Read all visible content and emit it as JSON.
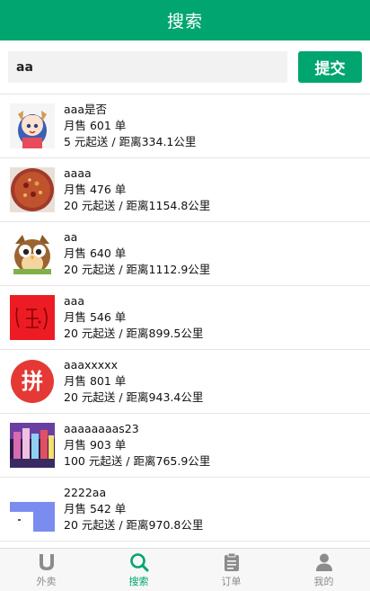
{
  "header": {
    "title": "搜索"
  },
  "search": {
    "value": "aa",
    "submit_label": "提交"
  },
  "shops": [
    {
      "name": "aaa是否",
      "sales": "月售 601 单",
      "delivery": "5 元起送 / 距离334.1公里"
    },
    {
      "name": "aaaa",
      "sales": "月售 476 单",
      "delivery": "20 元起送 / 距离1154.8公里"
    },
    {
      "name": "aa",
      "sales": "月售 640 单",
      "delivery": "20 元起送 / 距离1112.9公里"
    },
    {
      "name": "aaa",
      "sales": "月售 546 单",
      "delivery": "20 元起送 / 距离899.5公里"
    },
    {
      "name": "aaaxxxxx",
      "sales": "月售 801 单",
      "delivery": "20 元起送 / 距离943.4公里"
    },
    {
      "name": "aaaaaaaas23",
      "sales": "月售 903 单",
      "delivery": "100 元起送 / 距离765.9公里"
    },
    {
      "name": "2222aa",
      "sales": "月售 542 单",
      "delivery": "20 元起送 / 距离970.8公里"
    }
  ],
  "thumb_texts": {
    "red_logo": "拼"
  },
  "tabs": [
    {
      "label": "外卖",
      "icon": "u-icon"
    },
    {
      "label": "搜索",
      "icon": "search-icon"
    },
    {
      "label": "订单",
      "icon": "clipboard-icon"
    },
    {
      "label": "我的",
      "icon": "user-icon"
    }
  ],
  "colors": {
    "accent": "#01a56f",
    "inactive": "#8c8c8c"
  }
}
